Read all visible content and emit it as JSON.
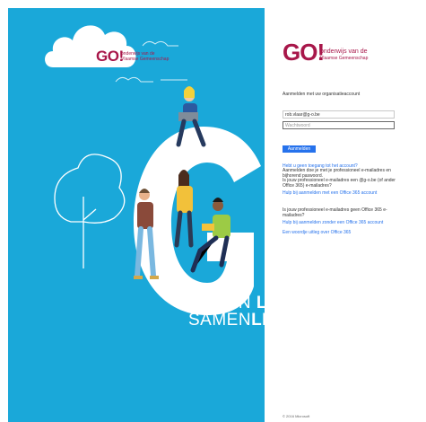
{
  "left": {
    "logo": {
      "brand": "GO!",
      "tagline_1": "onderwijs van de",
      "tagline_2": "Vlaamse Gemeenschap"
    },
    "slogan_1": {
      "prefix": "SAMEN ",
      "bold": "LE"
    },
    "slogan_2": {
      "prefix": "SAMEN",
      "bold": "LE"
    }
  },
  "form": {
    "brand": {
      "mark": "GO!",
      "tagline_1": "onderwijs van de",
      "tagline_2": "Vlaamse Gemeenschap"
    },
    "heading": "Aanmelden met uw organisatieaccount",
    "email_value": "rob.vlaar@g-o.be",
    "password_placeholder": "Wachtwoord",
    "signin_label": "Aanmelden",
    "forgot_link": "Hebt u geen toegang tot het account?",
    "forgot_text": "Aanmelden doe je met je professioneel e-mailadres en bijhorend paswoord.",
    "q1": "Is jouw professioneel e-mailadres een @g-o.be (of ander Office 365) e-mailadres?",
    "q1_link": "Hulp bij aanmelden met een Office 365 account",
    "q2": "Is jouw professioneel e-mailadres geen Office 365 e-mailadres?",
    "q2_link": "Hulp bij aanmelden zonder een Office 365 account",
    "explain_link": "Een woordje uitleg over Office 365",
    "footer": "© 2016 Microsoft"
  },
  "colors": {
    "background": "#1aa8d9",
    "brand": "#a8174a",
    "link": "#2672ec"
  }
}
